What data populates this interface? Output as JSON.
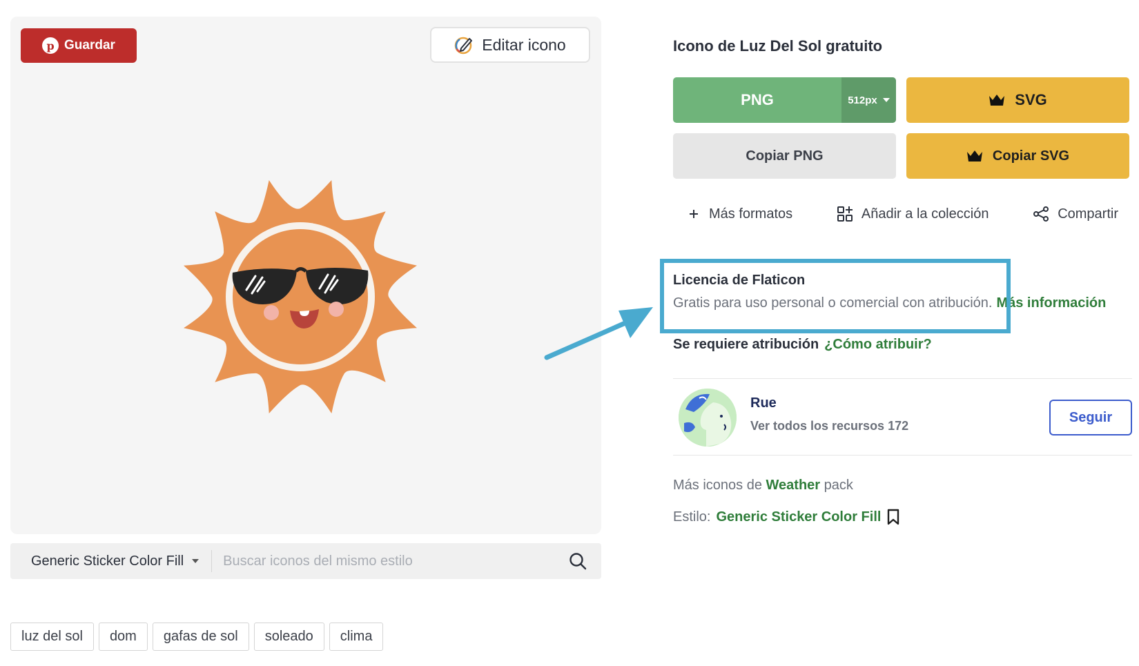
{
  "preview": {
    "save_label": "Guardar",
    "edit_label": "Editar icono"
  },
  "style_search": {
    "selected_style": "Generic Sticker Color Fill",
    "placeholder": "Buscar iconos del mismo estilo"
  },
  "tags": [
    "luz del sol",
    "dom",
    "gafas de sol",
    "soleado",
    "clima"
  ],
  "details": {
    "title": "Icono de Luz Del Sol gratuito",
    "png_label": "PNG",
    "png_size": "512px",
    "svg_label": "SVG",
    "copy_png_label": "Copiar PNG",
    "copy_svg_label": "Copiar SVG",
    "actions": {
      "more_formats": "Más formatos",
      "add_collection": "Añadir a la colección",
      "share": "Compartir"
    },
    "license": {
      "title": "Licencia de Flaticon",
      "description": "Gratis para uso personal o comercial con atribución.",
      "more_info": "Más información"
    },
    "attribution": {
      "label": "Se requiere atribución",
      "link": "¿Cómo atribuir?"
    },
    "author": {
      "name": "Rue",
      "resources": "Ver todos los recursos 172",
      "follow_label": "Seguir"
    },
    "more_icons": {
      "prefix": "Más iconos de",
      "pack": "Weather",
      "suffix": "pack"
    },
    "style": {
      "label": "Estilo:",
      "value": "Generic Sticker Color Fill"
    }
  },
  "colors": {
    "save_red": "#bd2d2b",
    "png_green": "#6fb47a",
    "premium_yellow": "#ebb740",
    "link_green": "#2f7d3a",
    "highlight_blue": "#4aaacf",
    "sun_orange": "#e89352"
  }
}
